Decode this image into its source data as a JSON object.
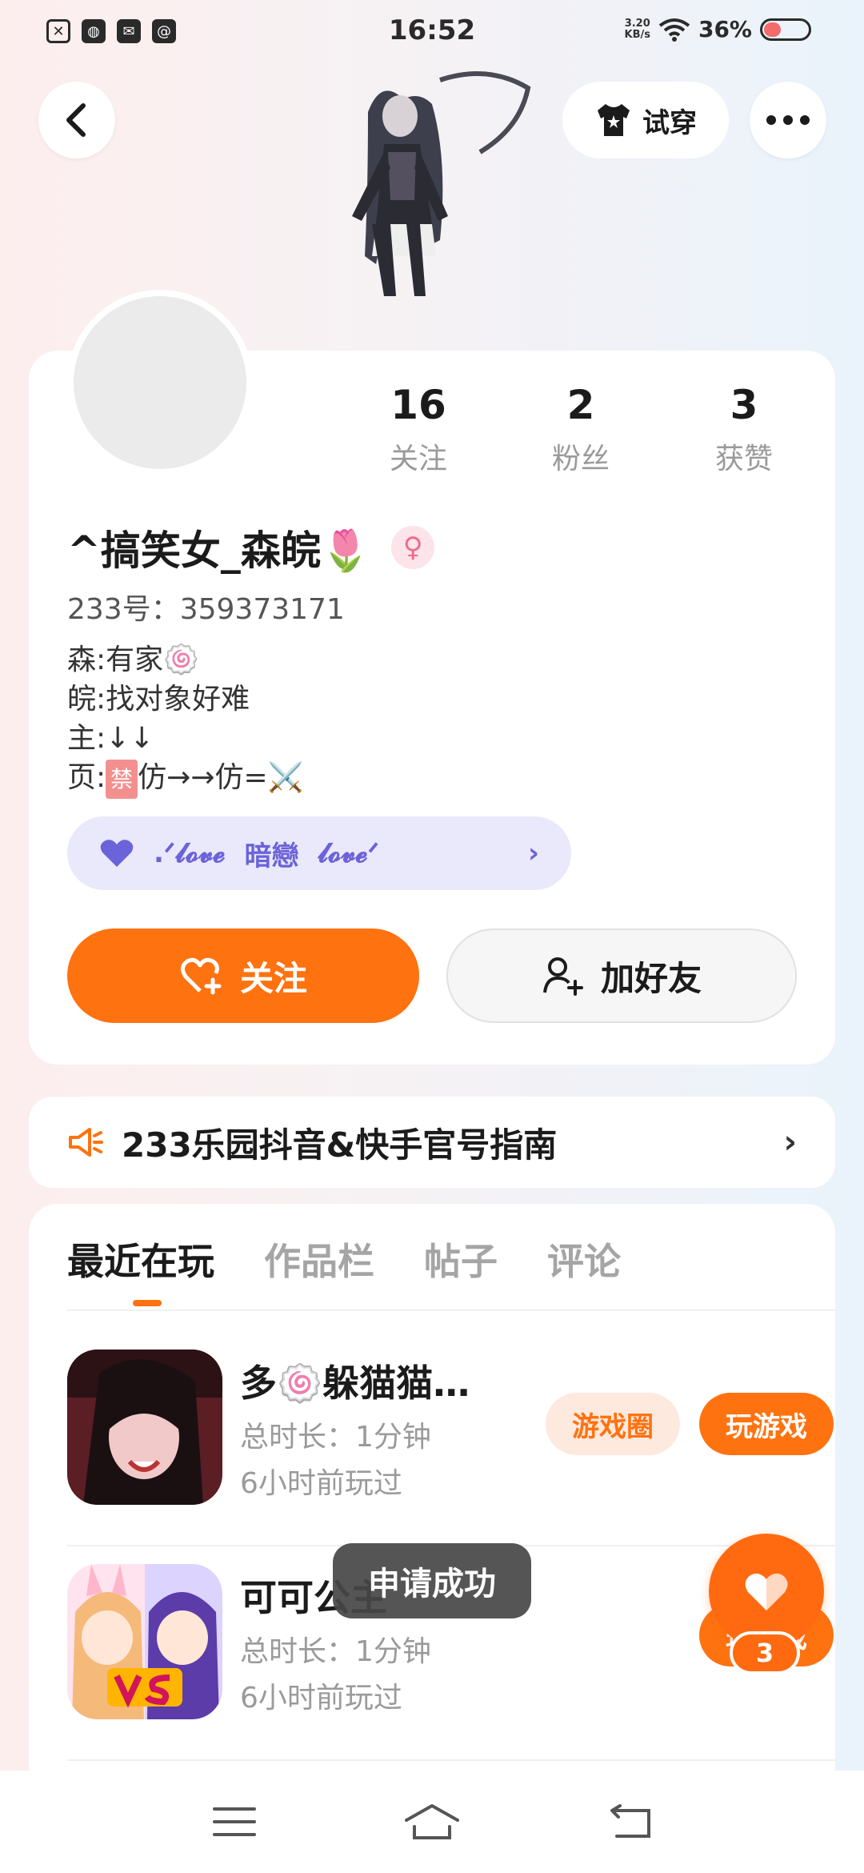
{
  "status_bar": {
    "time": "16:52",
    "net_speed_value": "3.20",
    "net_speed_unit": "KB/s",
    "battery": "36%",
    "battery_level": 0.36
  },
  "header": {
    "tryon_label": "试穿"
  },
  "profile": {
    "stats": [
      {
        "value": "16",
        "label": "关注"
      },
      {
        "value": "2",
        "label": "粉丝"
      },
      {
        "value": "3",
        "label": "获赞"
      }
    ],
    "nickname": "^搞笑女_森皖🌷",
    "gender_symbol": "♀",
    "uid": "233号：359373171",
    "bio_lines": [
      "森:有家🍥",
      "皖:找对象好难",
      "主:↓↓",
      "页:"
    ],
    "bio_line4_badge": "禁",
    "bio_line4_rest": "仿→→仿=⚔️",
    "tag_text_1": ".ᐟ𝓵𝓸𝓿𝓮",
    "tag_text_2": "暗戀",
    "tag_text_3": "𝓵𝓸𝓿𝓮ᐟ",
    "follow_label": "关注",
    "add_friend_label": "加好友"
  },
  "notice": {
    "text": "233乐园抖音&快手官号指南"
  },
  "tabs": [
    "最近在玩",
    "作品栏",
    "帖子",
    "评论"
  ],
  "games": [
    {
      "title": "多🍥躲猫猫…",
      "duration": "总时长：1分钟",
      "last_played": "6小时前玩过",
      "circle_label": "游戏圈",
      "play_label": "玩游戏"
    },
    {
      "title": "可可公主",
      "duration": "总时长：1分钟",
      "last_played": "6小时前玩过",
      "play_label": "玩游戏"
    }
  ],
  "toast": "申请成功",
  "like_count": "3",
  "colors": {
    "accent": "#ff7210",
    "tag_bg": "#eae8fb",
    "tag_text": "#6b63d9"
  }
}
